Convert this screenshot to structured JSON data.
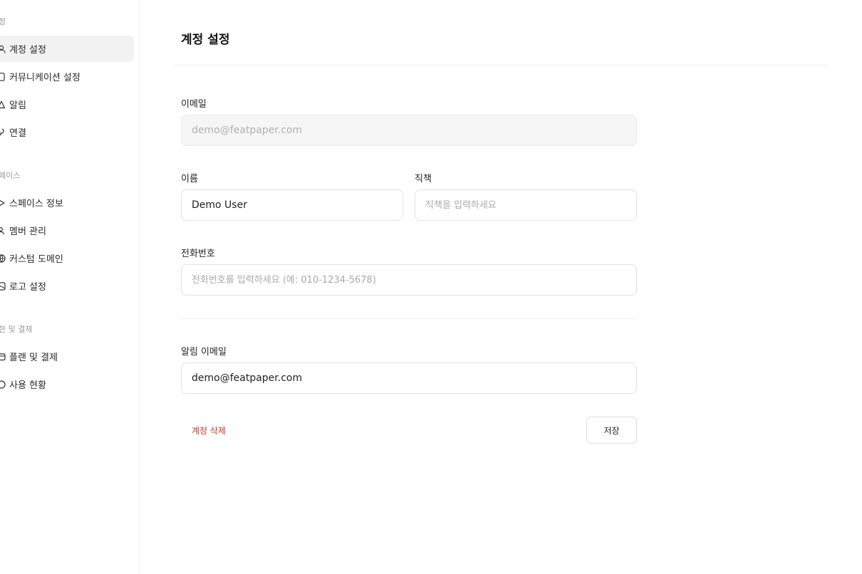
{
  "sidebar": {
    "sections": [
      {
        "label": "정"
      },
      {
        "label": "페이스"
      },
      {
        "label": "한 및 결제"
      }
    ],
    "items": [
      {
        "label": "계정 설정",
        "icon": "user-icon"
      },
      {
        "label": "커뮤니케이션 설정",
        "icon": "phone-icon"
      },
      {
        "label": "알림",
        "icon": "bell-icon"
      },
      {
        "label": "연결",
        "icon": "link-icon"
      },
      {
        "label": "스페이스 정보",
        "icon": "info-icon"
      },
      {
        "label": "멤버 관리",
        "icon": "users-icon"
      },
      {
        "label": "커스텀 도메인",
        "icon": "globe-icon"
      },
      {
        "label": "로고 설정",
        "icon": "image-icon"
      },
      {
        "label": "플랜 및 결제",
        "icon": "credit-card-icon"
      },
      {
        "label": "사용 현황",
        "icon": "chart-icon"
      }
    ]
  },
  "main": {
    "title": "계정 설정",
    "email": {
      "label": "이메일",
      "value": "demo@featpaper.com"
    },
    "name": {
      "label": "이름",
      "value": "Demo User"
    },
    "job_title": {
      "label": "직책",
      "value": "",
      "placeholder": "직책을 입력하세요"
    },
    "phone": {
      "label": "전화번호",
      "value": "",
      "placeholder": "전화번호를 입력하세요 (예: 010-1234-5678)"
    },
    "notification_email": {
      "label": "알림 이메일",
      "value": "demo@featpaper.com"
    },
    "delete_label": "계정 삭제",
    "save_label": "저장"
  },
  "colors": {
    "danger": "#c0392b",
    "active_bg": "#f2f2f2",
    "border": "#e2e2e2"
  }
}
